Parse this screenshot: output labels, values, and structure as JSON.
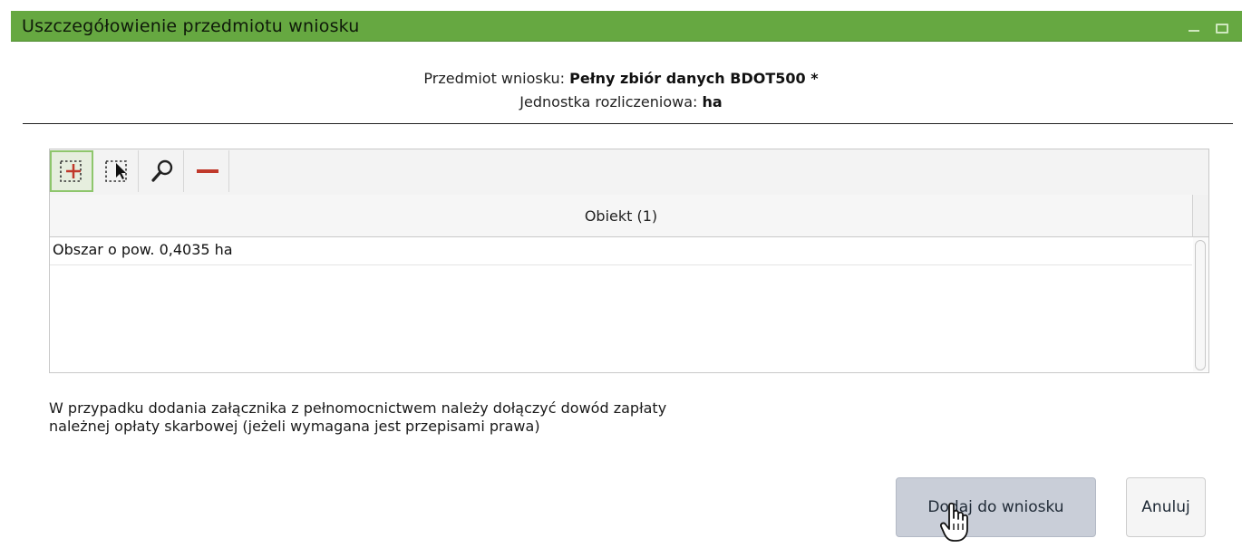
{
  "window": {
    "title": "Uszczegółowienie przedmiotu wniosku",
    "accent_color": "#66a841"
  },
  "info": {
    "subject_label": "Przedmiot wniosku: ",
    "subject_value": "Pełny zbiór danych BDOT500 *",
    "unit_label": "Jednostka rozliczeniowa: ",
    "unit_value": "ha"
  },
  "toolbar": {
    "buttons": [
      {
        "icon": "add-selection-icon",
        "active": true
      },
      {
        "icon": "select-object-icon",
        "active": false
      },
      {
        "icon": "zoom-icon",
        "active": false
      },
      {
        "icon": "remove-icon",
        "active": false
      }
    ]
  },
  "table": {
    "column_header": "Obiekt (1)",
    "rows": [
      "Obszar o pow. 0,4035 ha"
    ]
  },
  "note": {
    "line1": "W przypadku dodania załącznika z pełnomocnictwem należy dołączyć dowód zapłaty",
    "line2": "należnej opłaty skarbowej (jeżeli wymagana jest przepisami prawa)"
  },
  "actions": {
    "add_label": "Dodaj do wniosku",
    "cancel_label": "Anuluj"
  }
}
